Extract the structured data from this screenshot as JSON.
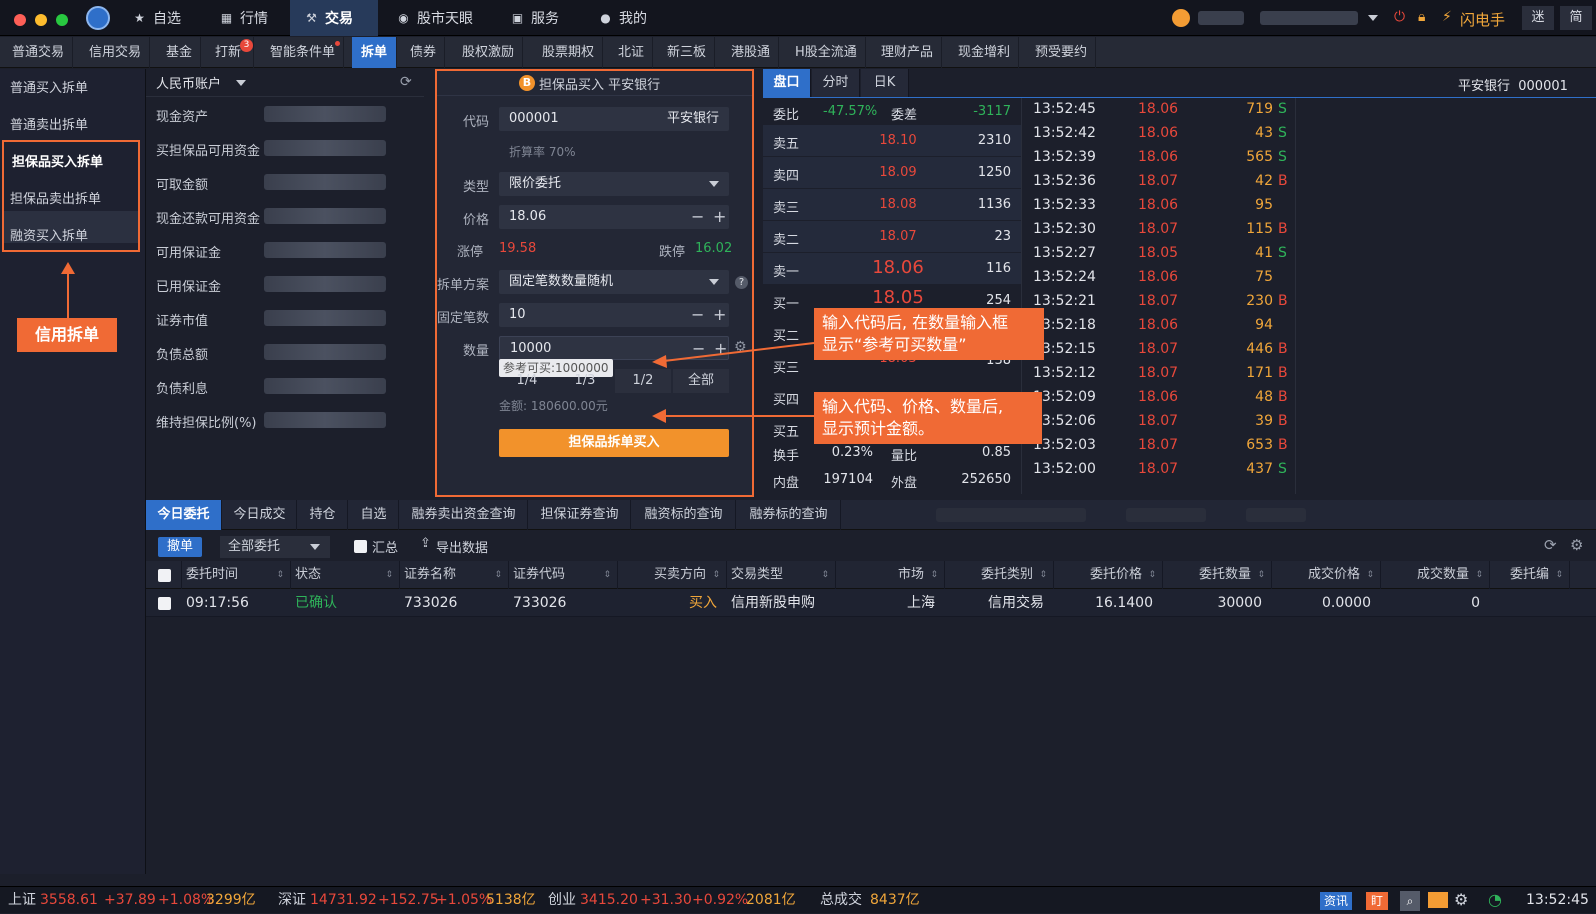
{
  "titlebar": {
    "nav": [
      "自选",
      "行情",
      "交易",
      "股市天眼",
      "服务",
      "我的"
    ],
    "user_name": "",
    "right_label": "闪电手",
    "btn_mi": "迷",
    "btn_jian": "简"
  },
  "subtabs": [
    "普通交易",
    "信用交易",
    "基金",
    "打新",
    "智能条件单",
    "拆单",
    "债券",
    "股权激励",
    "股票期权",
    "北证",
    "新三板",
    "港股通",
    "H股全流通",
    "理财产品",
    "现金增利",
    "预受要约"
  ],
  "subtab_badge": "3",
  "leftmenu": {
    "items": [
      "普通买入拆单",
      "普通卖出拆单",
      "担保品买入拆单",
      "担保品卖出拆单",
      "融资买入拆单"
    ],
    "callout": "信用拆单"
  },
  "account": {
    "selector": "人民币账户",
    "rows": [
      "现金资产",
      "买担保品可用资金",
      "可取金额",
      "现金还款可用资金",
      "可用保证金",
      "已用保证金",
      "证券市值",
      "负债总额",
      "负债利息",
      "维持担保比例(%)"
    ]
  },
  "order": {
    "title_badge": "B",
    "title": "担保品买入 平安银行",
    "code_label": "代码",
    "code": "000001",
    "stock_name": "平安银行",
    "discount": "折算率 70%",
    "type_label": "类型",
    "type": "限价委托",
    "price_label": "价格",
    "price": "18.06",
    "up_label": "涨停",
    "up": "19.58",
    "down_label": "跌停",
    "down": "16.02",
    "plan_label": "拆单方案",
    "plan": "固定笔数数量随机",
    "count_label": "固定笔数",
    "count": "10",
    "qty_label": "数量",
    "qty": "10000",
    "ref_tip": "参考可买:1000000",
    "ratios": [
      "1/4",
      "1/3",
      "1/2",
      "全部"
    ],
    "amount": "金额: 180600.00元",
    "buy_button": "担保品拆单买入"
  },
  "pankou": {
    "tabs": [
      "盘口",
      "分时",
      "日K"
    ],
    "stock": "平安银行  000001",
    "weibi_label": "委比",
    "weibi": "-47.57%",
    "weicha_label": "委差",
    "weicha": "-3117",
    "book": [
      {
        "label": "卖五",
        "price": "18.10",
        "vol": "2310"
      },
      {
        "label": "卖四",
        "price": "18.09",
        "vol": "1250"
      },
      {
        "label": "卖三",
        "price": "18.08",
        "vol": "1136"
      },
      {
        "label": "卖二",
        "price": "18.07",
        "vol": "23"
      },
      {
        "label": "卖一",
        "price": "18.06",
        "vol": "116"
      },
      {
        "label": "买一",
        "price": "18.05",
        "vol": "254"
      },
      {
        "label": "买二",
        "price": "",
        "vol": ""
      },
      {
        "label": "买三",
        "price": "18.03",
        "vol": "138"
      },
      {
        "label": "买四",
        "price": "",
        "vol": ""
      },
      {
        "label": "买五",
        "price": "",
        "vol": ""
      }
    ],
    "huanshou_label": "换手",
    "huanshou": "0.23%",
    "liangbi_label": "量比",
    "liangbi": "0.85",
    "neipan_label": "内盘",
    "neipan": "197104",
    "waipan_label": "外盘",
    "waipan": "252650",
    "ticks": [
      {
        "t": "13:52:45",
        "p": "18.06",
        "v": "719",
        "f": "S"
      },
      {
        "t": "13:52:42",
        "p": "18.06",
        "v": "43",
        "f": "S"
      },
      {
        "t": "13:52:39",
        "p": "18.06",
        "v": "565",
        "f": "S"
      },
      {
        "t": "13:52:36",
        "p": "18.07",
        "v": "42",
        "f": "B"
      },
      {
        "t": "13:52:33",
        "p": "18.06",
        "v": "95",
        "f": ""
      },
      {
        "t": "13:52:30",
        "p": "18.07",
        "v": "115",
        "f": "B"
      },
      {
        "t": "13:52:27",
        "p": "18.05",
        "v": "41",
        "f": "S"
      },
      {
        "t": "13:52:24",
        "p": "18.06",
        "v": "75",
        "f": ""
      },
      {
        "t": "13:52:21",
        "p": "18.07",
        "v": "230",
        "f": "B"
      },
      {
        "t": "13:52:18",
        "p": "18.06",
        "v": "94",
        "f": ""
      },
      {
        "t": "13:52:15",
        "p": "18.07",
        "v": "446",
        "f": "B"
      },
      {
        "t": "13:52:12",
        "p": "18.07",
        "v": "171",
        "f": "B"
      },
      {
        "t": "13:52:09",
        "p": "18.06",
        "v": "48",
        "f": "B"
      },
      {
        "t": "13:52:06",
        "p": "18.07",
        "v": "39",
        "f": "B"
      },
      {
        "t": "13:52:03",
        "p": "18.07",
        "v": "653",
        "f": "B"
      },
      {
        "t": "13:52:00",
        "p": "18.07",
        "v": "437",
        "f": "S"
      }
    ]
  },
  "annotations": {
    "a1_line1": "输入代码后, 在数量输入框",
    "a1_line2": "显示“参考可买数量”",
    "a2_line1": "输入代码、价格、数量后,",
    "a2_line2": "显示预计金额。"
  },
  "bottom_tabs": [
    "今日委托",
    "今日成交",
    "持仓",
    "自选",
    "融券卖出资金查询",
    "担保证券查询",
    "融资标的查询",
    "融券标的查询"
  ],
  "toolbar": {
    "cancel": "撤单",
    "filter": "全部委托",
    "summary": "汇总",
    "export": "导出数据"
  },
  "grid": {
    "headers": [
      "委托时间",
      "状态",
      "证券名称",
      "证券代码",
      "买卖方向",
      "交易类型",
      "市场",
      "委托类别",
      "委托价格",
      "委托数量",
      "成交价格",
      "成交数量",
      "委托编"
    ],
    "row": [
      "09:17:56",
      "已确认",
      "733026",
      "733026",
      "买入",
      "信用新股申购",
      "上海",
      "信用交易",
      "16.1400",
      "30000",
      "0.0000",
      "0"
    ]
  },
  "statusbar": {
    "sh": "上证",
    "sh_val": "3558.61",
    "sh_chg": "+37.89",
    "sh_pct": "+1.08%",
    "sh_amt": "3299亿",
    "sz": "深证",
    "sz_val": "14731.92",
    "sz_chg": "+152.75",
    "sz_pct": "+1.05%",
    "sz_amt": "5138亿",
    "cy": "创业",
    "cy_val": "3415.20",
    "cy_chg": "+31.30",
    "cy_pct": "+0.92%",
    "cy_amt": "2081亿",
    "total": "总成交",
    "total_amt": "8437亿",
    "news": "资讯",
    "ding": "盯",
    "clock": "13:52:45"
  },
  "colors": {
    "accent": "#2f6fc9",
    "annot": "#f06a35",
    "up": "#e8483b",
    "down": "#2fb35a",
    "buy": "#f2922b"
  }
}
